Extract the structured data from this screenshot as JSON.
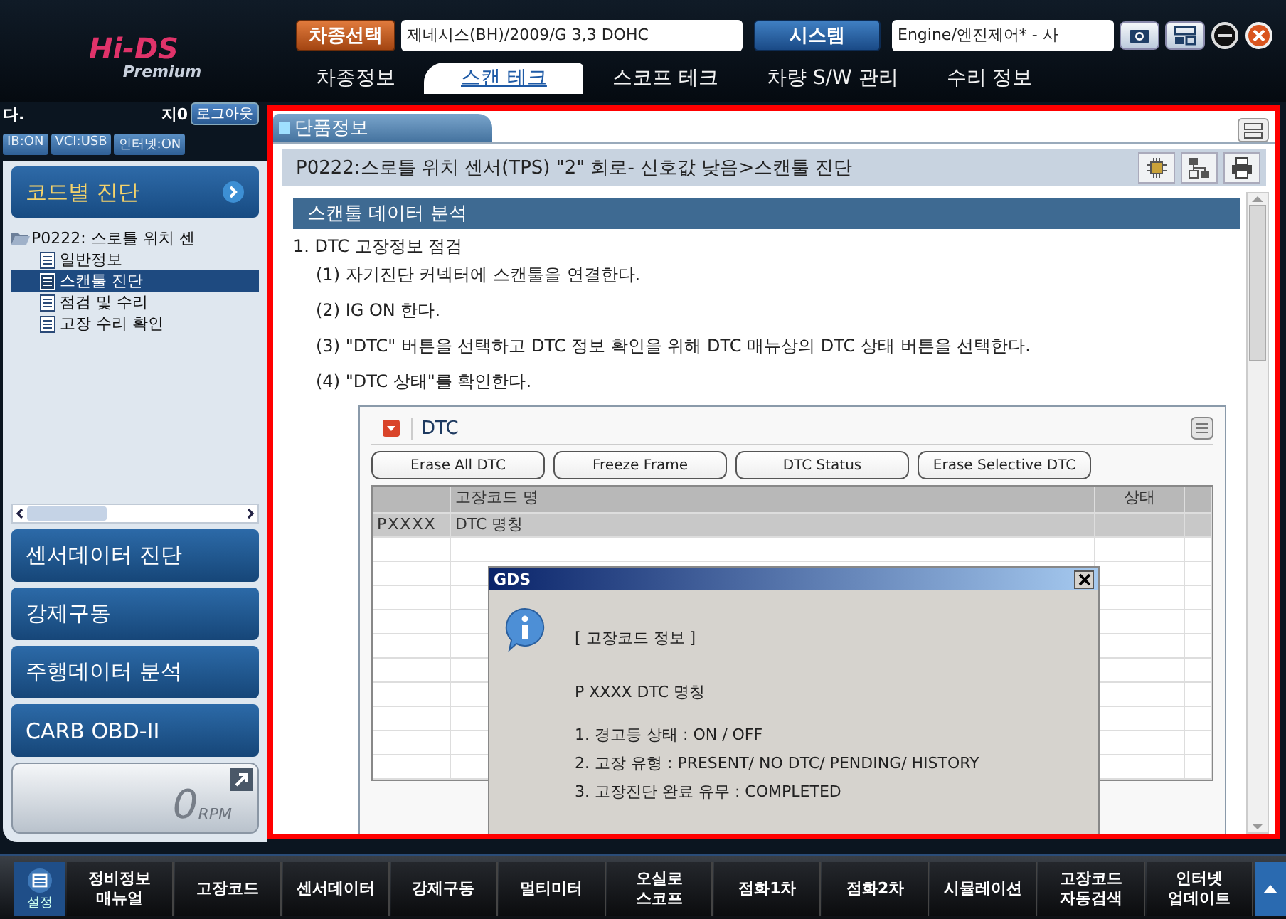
{
  "logo": {
    "title": "Hi-DS",
    "subtitle": "Premium"
  },
  "header": {
    "vehicle_button": "차종선택",
    "vehicle": "제네시스(BH)/2009/G 3,3 DOHC",
    "system_button": "시스템",
    "system": "Engine/엔진제어* - 사"
  },
  "tabs": [
    {
      "label": "차종정보",
      "selected": false
    },
    {
      "label": "스캔 테크",
      "selected": true
    },
    {
      "label": "스코프 테크",
      "selected": false
    },
    {
      "label": "차량 S/W 관리",
      "selected": false
    },
    {
      "label": "수리 정보",
      "selected": false
    }
  ],
  "user": {
    "name": "다.",
    "id": "지0",
    "logout": "로그아웃"
  },
  "status_badges": [
    "IB:ON",
    "VCI:USB",
    "인터넷:ON"
  ],
  "left_menu": {
    "header": "코드별 진단",
    "tree": [
      {
        "label": "P0222: 스로틀 위치 센",
        "expanded": true,
        "children": [
          {
            "label": "일반정보",
            "selected": false
          },
          {
            "label": "스캔툴 진단",
            "selected": true
          },
          {
            "label": "점검 및 수리",
            "selected": false
          },
          {
            "label": "고장 수리 확인",
            "selected": false
          }
        ]
      }
    ]
  },
  "menu_buttons": [
    "센서데이터 진단",
    "강제구동",
    "주행데이터 분석",
    "CARB OBD-II"
  ],
  "rpm": {
    "value": "0",
    "unit": "RPM"
  },
  "panel": {
    "tab": "단품정보",
    "title": "P0222:스로틀 위치 센서(TPS) \"2\" 회로- 신호값 낮음>스캔툴 진단",
    "section": "스캔툴 데이터 분석",
    "steps": [
      {
        "text": "1. DTC 고장정보 점검",
        "children": [
          {
            "text": "(1) 자기진단 커넥터에 스캔툴을 연결한다."
          },
          {
            "text": "(2) IG ON 한다."
          },
          {
            "text": "(3) \"DTC\" 버튼을 선택하고 DTC 정보 확인을 위해 DTC 매뉴상의 DTC 상태 버튼을 선택한다."
          },
          {
            "text": "(4) \"DTC 상태\"를 확인한다."
          }
        ]
      }
    ]
  },
  "dtc": {
    "title": "DTC",
    "buttons": [
      "Erase All DTC",
      "Freeze Frame",
      "DTC Status",
      "Erase Selective DTC"
    ],
    "columns": [
      "고장코드 명",
      "상태"
    ],
    "rows": [
      {
        "code": "PXXXX",
        "name": "DTC 명칭",
        "selected": true
      }
    ]
  },
  "dialog": {
    "title": "GDS",
    "heading": "[ 고장코드 정보 ]",
    "dtc": "P XXXX DTC 명칭",
    "lines": [
      "1. 경고등 상태 : ON / OFF",
      "2. 고장 유형 : PRESENT/ NO DTC/ PENDING/ HISTORY",
      "3. 고장진단 완료 유무 : COMPLETED"
    ]
  },
  "taskbar": {
    "settings": "설정",
    "items": [
      "정비정보\n매뉴얼",
      "고장코드",
      "센서데이터",
      "강제구동",
      "멀티미터",
      "오실로\n스코프",
      "점화1차",
      "점화2차",
      "시뮬레이션",
      "고장코드\n자동검색",
      "인터넷\n업데이트"
    ]
  }
}
